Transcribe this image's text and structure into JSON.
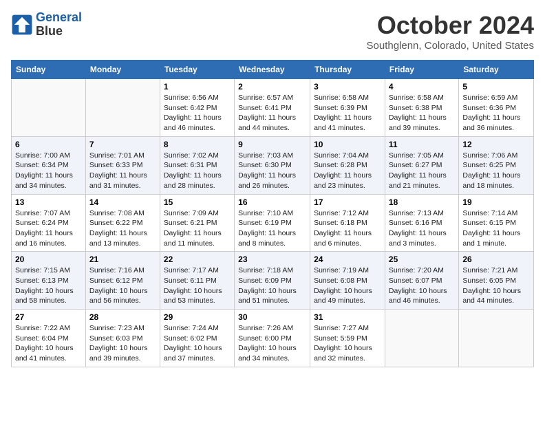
{
  "header": {
    "logo_line1": "General",
    "logo_line2": "Blue",
    "month": "October 2024",
    "location": "Southglenn, Colorado, United States"
  },
  "weekdays": [
    "Sunday",
    "Monday",
    "Tuesday",
    "Wednesday",
    "Thursday",
    "Friday",
    "Saturday"
  ],
  "weeks": [
    [
      {
        "day": "",
        "info": ""
      },
      {
        "day": "",
        "info": ""
      },
      {
        "day": "1",
        "info": "Sunrise: 6:56 AM\nSunset: 6:42 PM\nDaylight: 11 hours and 46 minutes."
      },
      {
        "day": "2",
        "info": "Sunrise: 6:57 AM\nSunset: 6:41 PM\nDaylight: 11 hours and 44 minutes."
      },
      {
        "day": "3",
        "info": "Sunrise: 6:58 AM\nSunset: 6:39 PM\nDaylight: 11 hours and 41 minutes."
      },
      {
        "day": "4",
        "info": "Sunrise: 6:58 AM\nSunset: 6:38 PM\nDaylight: 11 hours and 39 minutes."
      },
      {
        "day": "5",
        "info": "Sunrise: 6:59 AM\nSunset: 6:36 PM\nDaylight: 11 hours and 36 minutes."
      }
    ],
    [
      {
        "day": "6",
        "info": "Sunrise: 7:00 AM\nSunset: 6:34 PM\nDaylight: 11 hours and 34 minutes."
      },
      {
        "day": "7",
        "info": "Sunrise: 7:01 AM\nSunset: 6:33 PM\nDaylight: 11 hours and 31 minutes."
      },
      {
        "day": "8",
        "info": "Sunrise: 7:02 AM\nSunset: 6:31 PM\nDaylight: 11 hours and 28 minutes."
      },
      {
        "day": "9",
        "info": "Sunrise: 7:03 AM\nSunset: 6:30 PM\nDaylight: 11 hours and 26 minutes."
      },
      {
        "day": "10",
        "info": "Sunrise: 7:04 AM\nSunset: 6:28 PM\nDaylight: 11 hours and 23 minutes."
      },
      {
        "day": "11",
        "info": "Sunrise: 7:05 AM\nSunset: 6:27 PM\nDaylight: 11 hours and 21 minutes."
      },
      {
        "day": "12",
        "info": "Sunrise: 7:06 AM\nSunset: 6:25 PM\nDaylight: 11 hours and 18 minutes."
      }
    ],
    [
      {
        "day": "13",
        "info": "Sunrise: 7:07 AM\nSunset: 6:24 PM\nDaylight: 11 hours and 16 minutes."
      },
      {
        "day": "14",
        "info": "Sunrise: 7:08 AM\nSunset: 6:22 PM\nDaylight: 11 hours and 13 minutes."
      },
      {
        "day": "15",
        "info": "Sunrise: 7:09 AM\nSunset: 6:21 PM\nDaylight: 11 hours and 11 minutes."
      },
      {
        "day": "16",
        "info": "Sunrise: 7:10 AM\nSunset: 6:19 PM\nDaylight: 11 hours and 8 minutes."
      },
      {
        "day": "17",
        "info": "Sunrise: 7:12 AM\nSunset: 6:18 PM\nDaylight: 11 hours and 6 minutes."
      },
      {
        "day": "18",
        "info": "Sunrise: 7:13 AM\nSunset: 6:16 PM\nDaylight: 11 hours and 3 minutes."
      },
      {
        "day": "19",
        "info": "Sunrise: 7:14 AM\nSunset: 6:15 PM\nDaylight: 11 hours and 1 minute."
      }
    ],
    [
      {
        "day": "20",
        "info": "Sunrise: 7:15 AM\nSunset: 6:13 PM\nDaylight: 10 hours and 58 minutes."
      },
      {
        "day": "21",
        "info": "Sunrise: 7:16 AM\nSunset: 6:12 PM\nDaylight: 10 hours and 56 minutes."
      },
      {
        "day": "22",
        "info": "Sunrise: 7:17 AM\nSunset: 6:11 PM\nDaylight: 10 hours and 53 minutes."
      },
      {
        "day": "23",
        "info": "Sunrise: 7:18 AM\nSunset: 6:09 PM\nDaylight: 10 hours and 51 minutes."
      },
      {
        "day": "24",
        "info": "Sunrise: 7:19 AM\nSunset: 6:08 PM\nDaylight: 10 hours and 49 minutes."
      },
      {
        "day": "25",
        "info": "Sunrise: 7:20 AM\nSunset: 6:07 PM\nDaylight: 10 hours and 46 minutes."
      },
      {
        "day": "26",
        "info": "Sunrise: 7:21 AM\nSunset: 6:05 PM\nDaylight: 10 hours and 44 minutes."
      }
    ],
    [
      {
        "day": "27",
        "info": "Sunrise: 7:22 AM\nSunset: 6:04 PM\nDaylight: 10 hours and 41 minutes."
      },
      {
        "day": "28",
        "info": "Sunrise: 7:23 AM\nSunset: 6:03 PM\nDaylight: 10 hours and 39 minutes."
      },
      {
        "day": "29",
        "info": "Sunrise: 7:24 AM\nSunset: 6:02 PM\nDaylight: 10 hours and 37 minutes."
      },
      {
        "day": "30",
        "info": "Sunrise: 7:26 AM\nSunset: 6:00 PM\nDaylight: 10 hours and 34 minutes."
      },
      {
        "day": "31",
        "info": "Sunrise: 7:27 AM\nSunset: 5:59 PM\nDaylight: 10 hours and 32 minutes."
      },
      {
        "day": "",
        "info": ""
      },
      {
        "day": "",
        "info": ""
      }
    ]
  ]
}
